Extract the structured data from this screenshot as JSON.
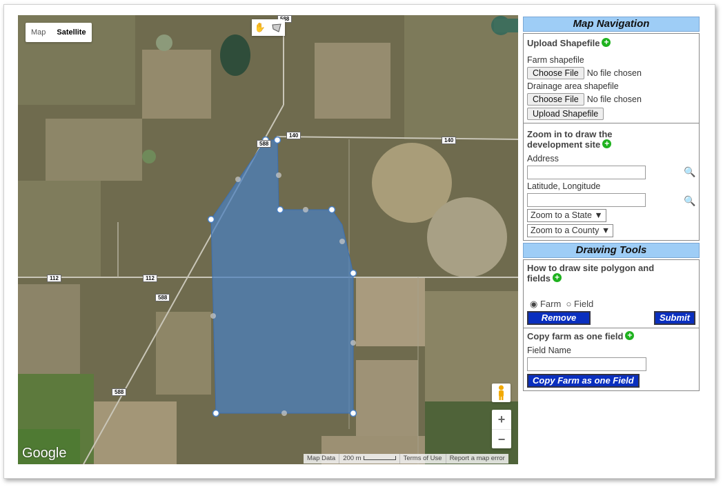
{
  "map": {
    "type_map": "Map",
    "type_satellite": "Satellite",
    "zoom_in": "+",
    "zoom_out": "−",
    "logo": "Google",
    "attribution": {
      "map_data": "Map Data",
      "scale": "200 m",
      "terms": "Terms of Use",
      "report": "Report a map error"
    },
    "road_labels": {
      "r588_top": "588",
      "r140_a": "140",
      "r140_b": "140",
      "r588_mid": "588",
      "r588_b": "588",
      "r588_bot": "588",
      "r112_a": "112",
      "r112_b": "112"
    },
    "icons": [
      "hand-icon",
      "polygon-icon",
      "pegman-icon"
    ]
  },
  "navigation": {
    "title": "Map Navigation",
    "upload_title": "Upload Shapefile",
    "farm_label": "Farm shapefile",
    "choose_file": "Choose File",
    "no_file": "No file chosen",
    "drainage_label": "Drainage area shapefile",
    "choose_file2": "Choose File",
    "no_file2": "No file chosen",
    "upload_button": "Upload Shapefile",
    "zoom_title": "Zoom in to draw the development site",
    "address_label": "Address",
    "latlng_label": "Latitude, Longitude",
    "state_select": "Zoom to a State",
    "county_select": "Zoom to a County"
  },
  "drawing": {
    "title": "Drawing Tools",
    "howto_title": "How to draw site polygon and fields",
    "radio_farm": "Farm",
    "radio_field": "Field",
    "radio_selected": "Farm",
    "remove": "Remove",
    "submit": "Submit",
    "copy_title": "Copy farm as one field",
    "field_name_label": "Field Name",
    "copy_button": "Copy Farm as one Field"
  },
  "colors": {
    "header_bg": "#9ecdf6",
    "blue_button": "#0a2fbf",
    "polygon_fill": "#4a7fc1",
    "plus_green": "#1fb21f"
  }
}
